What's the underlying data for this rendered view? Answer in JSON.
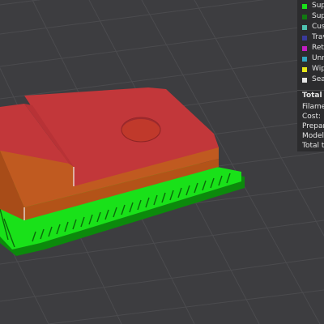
{
  "legend": {
    "items": [
      {
        "label": "Sup",
        "color": "#19e119"
      },
      {
        "label": "Sup",
        "color": "#117a11"
      },
      {
        "label": "Cust",
        "color": "#4fc2b0"
      },
      {
        "label": "Trav",
        "color": "#3a3a9a"
      },
      {
        "label": "Retr",
        "color": "#c21ec2"
      },
      {
        "label": "Unre",
        "color": "#33a6c1"
      },
      {
        "label": "Wip",
        "color": "#e6e61a"
      },
      {
        "label": "Sea",
        "color": "#e6e6e6"
      }
    ]
  },
  "summary": {
    "title": "Total e",
    "rows": [
      {
        "label": "Filamer"
      },
      {
        "label": "Cost:"
      },
      {
        "label": "Prepare"
      },
      {
        "label": "Model"
      },
      {
        "label": "Total ti"
      }
    ]
  },
  "colors": {
    "background": "#3d3d40",
    "grid_line": "#4b4b4e",
    "support_green": "#19e119",
    "support_dark": "#0c8a0c",
    "model_top": "#c2373a",
    "model_side": "#c05a20",
    "panel_bg": "#2c2c2e"
  }
}
